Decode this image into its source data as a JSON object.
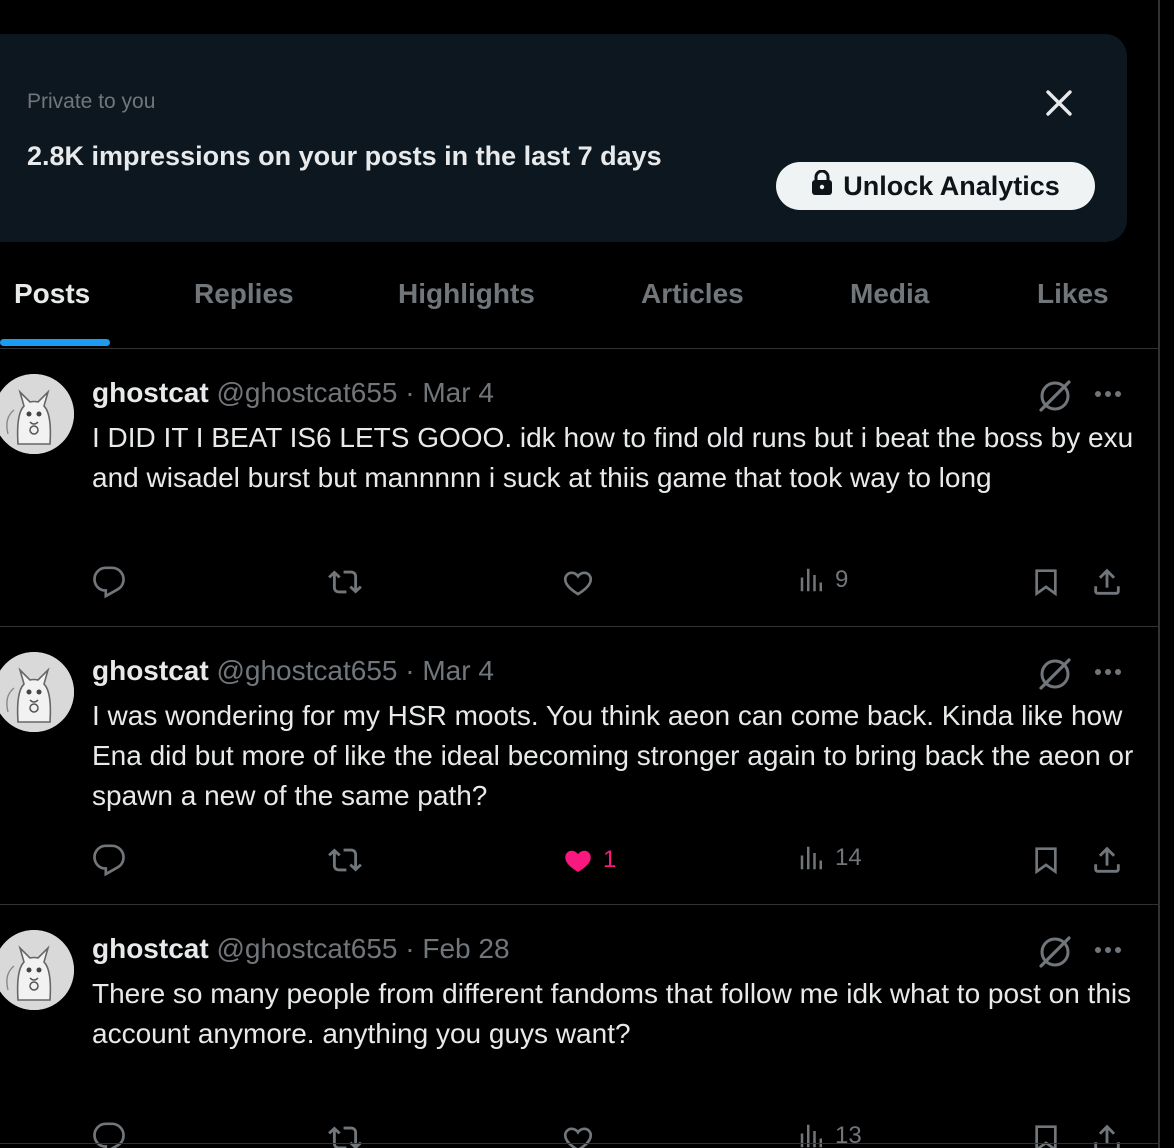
{
  "banner": {
    "kicker": "Private to you",
    "title": "2.8K impressions on your posts in the last 7 days",
    "unlock_label": "Unlock Analytics",
    "close_icon": "close-icon",
    "lock_icon": "lock-icon"
  },
  "tabs": [
    {
      "label": "Posts",
      "active": true
    },
    {
      "label": "Replies",
      "active": false
    },
    {
      "label": "Highlights",
      "active": false
    },
    {
      "label": "Articles",
      "active": false
    },
    {
      "label": "Media",
      "active": false
    },
    {
      "label": "Likes",
      "active": false
    }
  ],
  "posts": [
    {
      "name": "ghostcat",
      "handle": "@ghostcat655",
      "separator": "·",
      "date": "Mar 4",
      "text": "I DID IT I BEAT IS6 LETS GOOO. idk how to find old runs but i beat the boss by exu and wisadel burst but mannnnn i suck at thiis game that took way to long",
      "replies": "",
      "reposts": "",
      "likes": "",
      "liked": false,
      "views": "9"
    },
    {
      "name": "ghostcat",
      "handle": "@ghostcat655",
      "separator": "·",
      "date": "Mar 4",
      "text": "I was wondering for my HSR moots. You think aeon can come back. Kinda like how Ena did but more of like the ideal becoming stronger again to bring back the aeon or spawn a new of the same path?",
      "replies": "",
      "reposts": "",
      "likes": "1",
      "liked": true,
      "views": "14"
    },
    {
      "name": "ghostcat",
      "handle": "@ghostcat655",
      "separator": "·",
      "date": "Feb 28",
      "text": "There so many people from different fandoms that follow me idk what to post on this account anymore. anything you guys want?",
      "replies": "",
      "reposts": "",
      "likes": "",
      "liked": false,
      "views": "13"
    }
  ],
  "colors": {
    "background": "#000000",
    "banner": "#0d1720",
    "text": "#e7e9ea",
    "muted": "#71767b",
    "accent": "#1d9bf0",
    "like": "#f91880"
  }
}
